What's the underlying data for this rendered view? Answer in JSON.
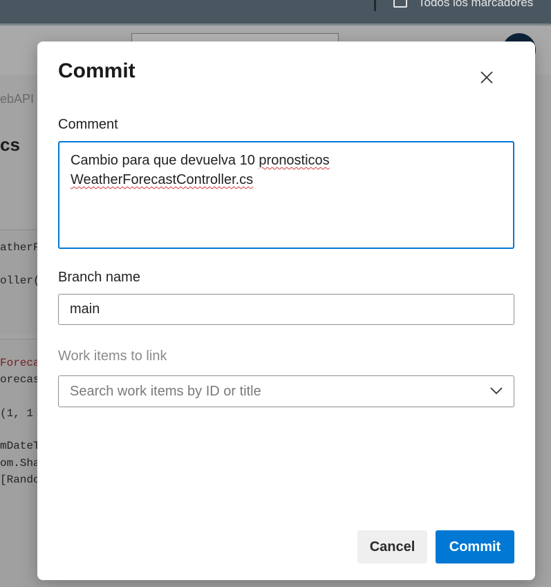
{
  "browser": {
    "bookmarks_label": "Todos los marcadores"
  },
  "background": {
    "breadcrumb": "ebAPI",
    "title": "cs",
    "code_lines_a": [
      "atherF",
      "oller("
    ],
    "code_lines_b": [
      "Foreca",
      "orecas",
      "(1, 1",
      "mDateT",
      "om.Sha",
      "[Rando"
    ]
  },
  "modal": {
    "title": "Commit",
    "comment_label": "Comment",
    "comment_line1_plain": "Cambio para que devuelva 10 ",
    "comment_line1_spell": "pronosticos",
    "comment_line2_spell": "WeatherForecastController.cs",
    "branch_label": "Branch name",
    "branch_value": "main",
    "workitems_label": "Work items to link",
    "workitems_placeholder": "Search work items by ID or title",
    "cancel_label": "Cancel",
    "commit_label": "Commit"
  },
  "colors": {
    "accent": "#0078d4",
    "overlay": "#a3a3a3",
    "spell_underline": "#d13438"
  },
  "icons": {
    "close": "close-icon",
    "dropdown": "chevron-down-icon",
    "bookmark_folder": "folder-icon"
  }
}
